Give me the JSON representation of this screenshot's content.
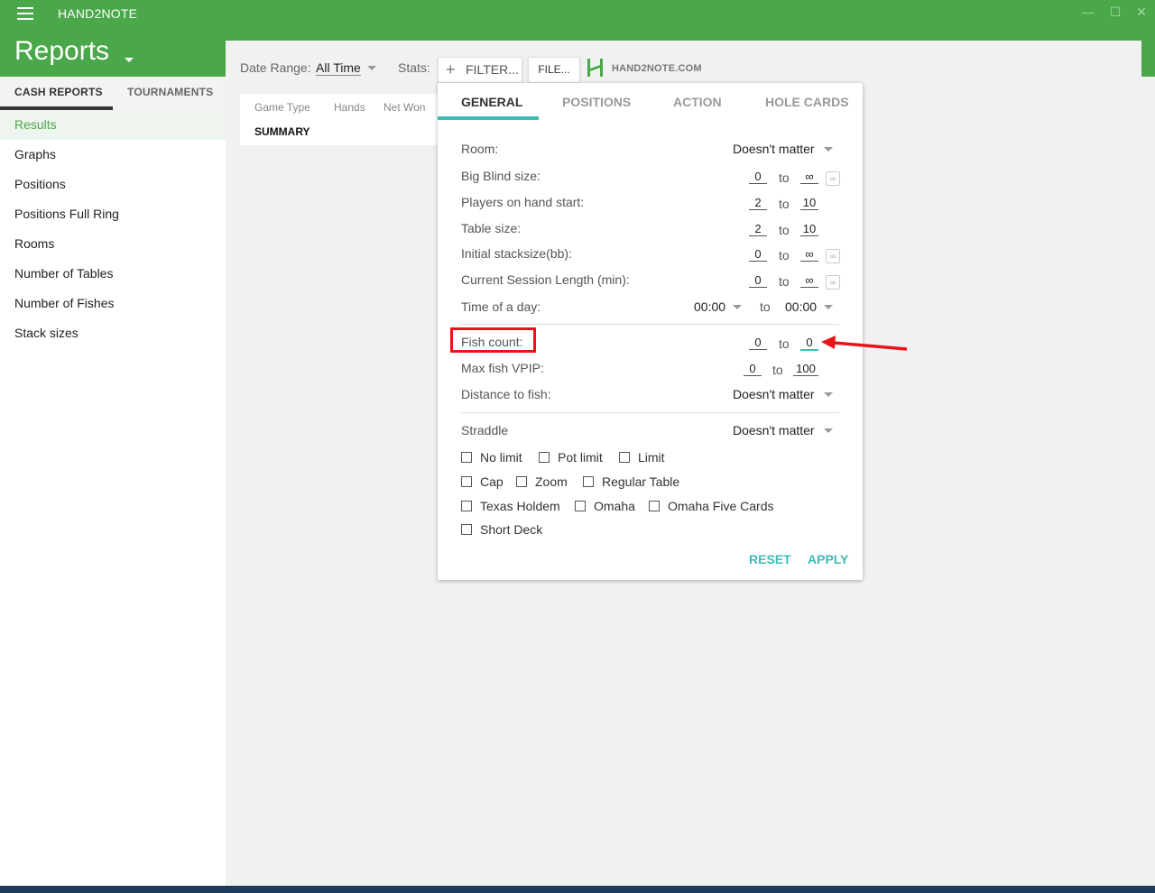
{
  "window": {
    "title": "HAND2NOTE",
    "min_icon": "—",
    "max_icon": "☐",
    "close_icon": "✕"
  },
  "header": {
    "title": "Reports"
  },
  "sidebar": {
    "tabs": [
      "CASH REPORTS",
      "TOURNAMENTS"
    ],
    "items": [
      "Results",
      "Graphs",
      "Positions",
      "Positions Full Ring",
      "Rooms",
      "Number of Tables",
      "Number of Fishes",
      "Stack sizes"
    ]
  },
  "toolbar": {
    "date_label": "Date Range:",
    "date_value": "All Time",
    "stats_label": "Stats:",
    "filter_label": "FILTER...",
    "file_label": "FILE...",
    "logo_text": "HAND2NOTE.COM"
  },
  "table": {
    "headers": [
      "Game Type",
      "Hands",
      "Net Won"
    ],
    "summary": "SUMMARY"
  },
  "filter": {
    "tabs": [
      "GENERAL",
      "POSITIONS",
      "ACTION",
      "HOLE CARDS"
    ],
    "room": {
      "label": "Room:",
      "value": "Doesn't matter"
    },
    "big_blind": {
      "label": "Big Blind size:",
      "from": "0",
      "to": "∞"
    },
    "players": {
      "label": "Players on hand start:",
      "from": "2",
      "to": "10"
    },
    "table_size": {
      "label": "Table size:",
      "from": "2",
      "to": "10"
    },
    "stacksize": {
      "label": "Initial stacksize(bb):",
      "from": "0",
      "to": "∞"
    },
    "session": {
      "label": "Current Session Length (min):",
      "from": "0",
      "to": "∞"
    },
    "time_of_day": {
      "label": "Time of a day:",
      "from": "00:00",
      "to": "00:00"
    },
    "fish_count": {
      "label": "Fish count:",
      "from": "0",
      "to": "0"
    },
    "max_vpip": {
      "label": "Max fish VPIP:",
      "from": "0",
      "to": "100"
    },
    "distance": {
      "label": "Distance to fish:",
      "value": "Doesn't matter"
    },
    "straddle": {
      "label": "Straddle",
      "value": "Doesn't matter"
    },
    "to_word": "to",
    "inf_icon": "∞",
    "checkboxes": [
      "No limit",
      "Pot limit",
      "Limit",
      "Cap",
      "Zoom",
      "Regular Table",
      "Texas Holdem",
      "Omaha",
      "Omaha Five Cards",
      "Short Deck"
    ],
    "reset_label": "RESET",
    "apply_label": "APPLY"
  },
  "colors": {
    "brand": "#4aa74a",
    "accent": "#3cbdb8",
    "annotation": "#e8141c"
  }
}
